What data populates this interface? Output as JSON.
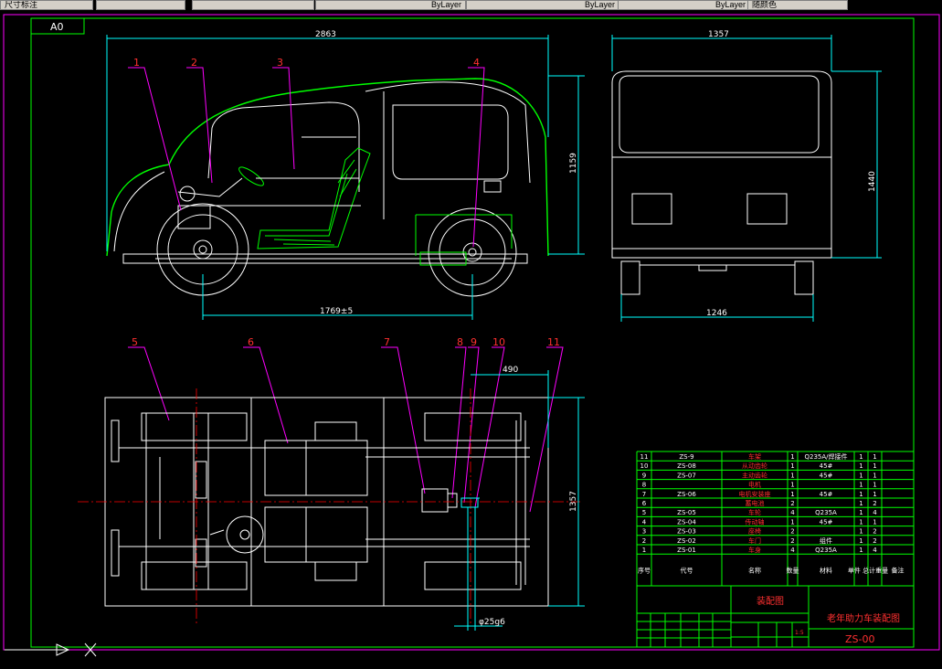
{
  "toolbar": {
    "layer_value": "尺寸标注",
    "color_value": "ByLayer",
    "linetype_value": "ByLayer",
    "lineweight_value": "ByLayer",
    "plot_style_value": "随颜色"
  },
  "sheet": {
    "size_label": "A0"
  },
  "dimensions": {
    "side_length": "2863",
    "side_height": "1159",
    "wheelbase": "1769±5",
    "front_width": "1357",
    "front_height": "1440",
    "track_width": "1246",
    "plan_offset": "490",
    "plan_width": "1357",
    "shaft_diameter": "φ25g6"
  },
  "balloons": [
    "1",
    "2",
    "3",
    "4",
    "5",
    "6",
    "7",
    "8",
    "9",
    "10",
    "11"
  ],
  "bom": {
    "rows": [
      {
        "no": "11",
        "code": "ZS-9",
        "name": "车架",
        "qty": "1",
        "material": "Q235A/焊接件",
        "w1": "1",
        "w2": "1"
      },
      {
        "no": "10",
        "code": "ZS-08",
        "name": "从动齿轮",
        "qty": "1",
        "material": "45#",
        "w1": "1",
        "w2": "1"
      },
      {
        "no": "9",
        "code": "ZS-07",
        "name": "主动齿轮",
        "qty": "1",
        "material": "45#",
        "w1": "1",
        "w2": "1"
      },
      {
        "no": "8",
        "code": "",
        "name": "电机",
        "qty": "1",
        "material": "",
        "w1": "1",
        "w2": "1"
      },
      {
        "no": "7",
        "code": "ZS-06",
        "name": "电机安装座",
        "qty": "1",
        "material": "45#",
        "w1": "1",
        "w2": "1"
      },
      {
        "no": "6",
        "code": "",
        "name": "蓄电池",
        "qty": "2",
        "material": "",
        "w1": "1",
        "w2": "2"
      },
      {
        "no": "5",
        "code": "ZS-05",
        "name": "车轮",
        "qty": "4",
        "material": "Q235A",
        "w1": "1",
        "w2": "4"
      },
      {
        "no": "4",
        "code": "ZS-04",
        "name": "传动轴",
        "qty": "1",
        "material": "45#",
        "w1": "1",
        "w2": "1"
      },
      {
        "no": "3",
        "code": "ZS-03",
        "name": "座椅",
        "qty": "2",
        "material": "",
        "w1": "1",
        "w2": "2"
      },
      {
        "no": "2",
        "code": "ZS-02",
        "name": "车门",
        "qty": "2",
        "material": "组件",
        "w1": "1",
        "w2": "2"
      },
      {
        "no": "1",
        "code": "ZS-01",
        "name": "车身",
        "qty": "4",
        "material": "Q235A",
        "w1": "1",
        "w2": "4"
      }
    ],
    "header": {
      "no": "序号",
      "code": "代号",
      "name": "名称",
      "qty": "数量",
      "material": "材料",
      "weight": "单件 总计重量",
      "remark": "备注"
    }
  },
  "title_block": {
    "drawing_type": "装配图",
    "title": "老年助力车装配图",
    "drawing_no": "ZS-00",
    "scale": "1:5"
  },
  "colors": {
    "background": "#000000",
    "outline": "#ffffff",
    "border": "#00ff00",
    "dimension": "#00ffff",
    "leader": "#ff00ff",
    "balloon": "#ff3030",
    "centerline": "#ff0000",
    "hatch": "#00ff00",
    "title_text": "#ff3030"
  }
}
